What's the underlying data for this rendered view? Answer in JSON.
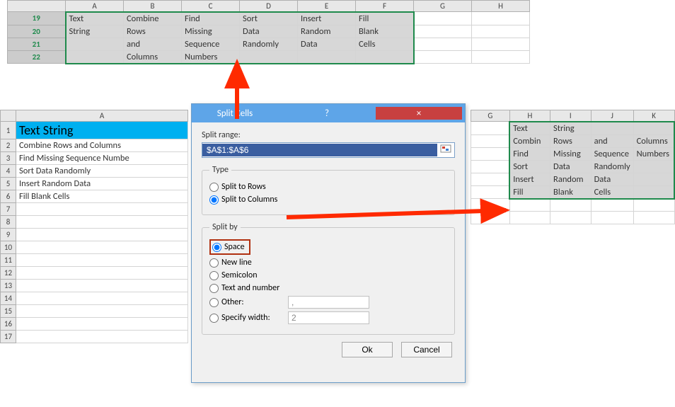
{
  "top_grid": {
    "col_headers": [
      "A",
      "B",
      "C",
      "D",
      "E",
      "F",
      "G",
      "H"
    ],
    "rows": [
      {
        "n": "19",
        "c": [
          "Text",
          "Combine",
          "Find",
          "Sort",
          "Insert",
          "Fill"
        ]
      },
      {
        "n": "20",
        "c": [
          "String",
          "Rows",
          "Missing",
          "Data",
          "Random",
          "Blank"
        ]
      },
      {
        "n": "21",
        "c": [
          "",
          "and",
          "Sequence",
          "Randomly",
          "Data",
          "Cells"
        ]
      },
      {
        "n": "22",
        "c": [
          "",
          "Columns",
          "Numbers",
          "",
          "",
          ""
        ]
      }
    ]
  },
  "left_grid": {
    "col_headers": [
      "A"
    ],
    "rows": [
      {
        "n": "1",
        "val": "Text String",
        "hd": true
      },
      {
        "n": "2",
        "val": "Combine Rows and Columns"
      },
      {
        "n": "3",
        "val": "Find Missing Sequence Numbe"
      },
      {
        "n": "4",
        "val": "Sort Data Randomly"
      },
      {
        "n": "5",
        "val": "Insert Random Data"
      },
      {
        "n": "6",
        "val": "Fill Blank Cells"
      },
      {
        "n": "7",
        "val": ""
      },
      {
        "n": "8",
        "val": ""
      },
      {
        "n": "9",
        "val": ""
      },
      {
        "n": "10",
        "val": ""
      },
      {
        "n": "11",
        "val": ""
      },
      {
        "n": "12",
        "val": ""
      },
      {
        "n": "13",
        "val": ""
      },
      {
        "n": "14",
        "val": ""
      },
      {
        "n": "15",
        "val": ""
      },
      {
        "n": "16",
        "val": ""
      },
      {
        "n": "17",
        "val": ""
      }
    ]
  },
  "right_grid": {
    "col_headers": [
      "G",
      "H",
      "I",
      "J",
      "K"
    ],
    "first_row": "1",
    "rows": [
      [
        "",
        "Text",
        "String",
        "",
        ""
      ],
      [
        "",
        "Combin",
        "Rows",
        "and",
        "Columns"
      ],
      [
        "",
        "Find",
        "Missing",
        "Sequence",
        "Numbers"
      ],
      [
        "",
        "Sort",
        "Data",
        "Randomly",
        ""
      ],
      [
        "",
        "Insert",
        "Random",
        "Data",
        ""
      ],
      [
        "",
        "Fill",
        "Blank",
        "Cells",
        ""
      ],
      [
        "",
        "",
        "",
        "",
        ""
      ],
      [
        "",
        "",
        "",
        "",
        ""
      ]
    ]
  },
  "dialog": {
    "title": "Split Cells",
    "help": "?",
    "close": "×",
    "split_range_label": "Split range:",
    "split_range_value": "$A$1:$A$6",
    "type_legend": "Type",
    "type_rows": "Split to Rows",
    "type_cols": "Split to Columns",
    "splitby_legend": "Split by",
    "by_space": "Space",
    "by_newline": "New line",
    "by_semicolon": "Semicolon",
    "by_textnum": "Text and number",
    "by_other": "Other:",
    "by_other_val": ",",
    "by_width": "Specify width:",
    "by_width_val": "2",
    "ok": "Ok",
    "cancel": "Cancel"
  }
}
